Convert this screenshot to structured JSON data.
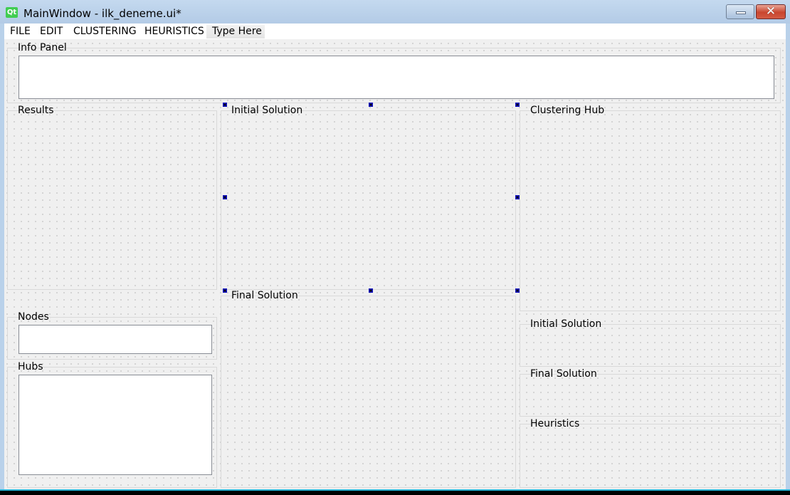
{
  "window": {
    "title": "MainWindow - ilk_deneme.ui*",
    "app_icon": "qt-logo-icon",
    "app_icon_text": "Qt",
    "minimize_symbol": "",
    "close_symbol": "✕"
  },
  "menubar": {
    "items": [
      {
        "label": "FILE"
      },
      {
        "label": "EDIT"
      },
      {
        "label": "CLUSTERING"
      },
      {
        "label": "HEURISTICS"
      }
    ],
    "type_here": "Type Here"
  },
  "panels": {
    "info_panel": "Info Panel",
    "results": "Results",
    "initial_solution": "Initial Solution",
    "final_solution": "Final Solution",
    "clustering_hub": "Clustering Hub",
    "nodes": "Nodes",
    "hubs": "Hubs",
    "right_initial_solution": "Initial Solution",
    "right_final_solution": "Final Solution",
    "heuristics": "Heuristics"
  },
  "colors": {
    "selection_handle": "#000080",
    "qt_green": "#41cd52",
    "close_red": "#c9462f"
  }
}
